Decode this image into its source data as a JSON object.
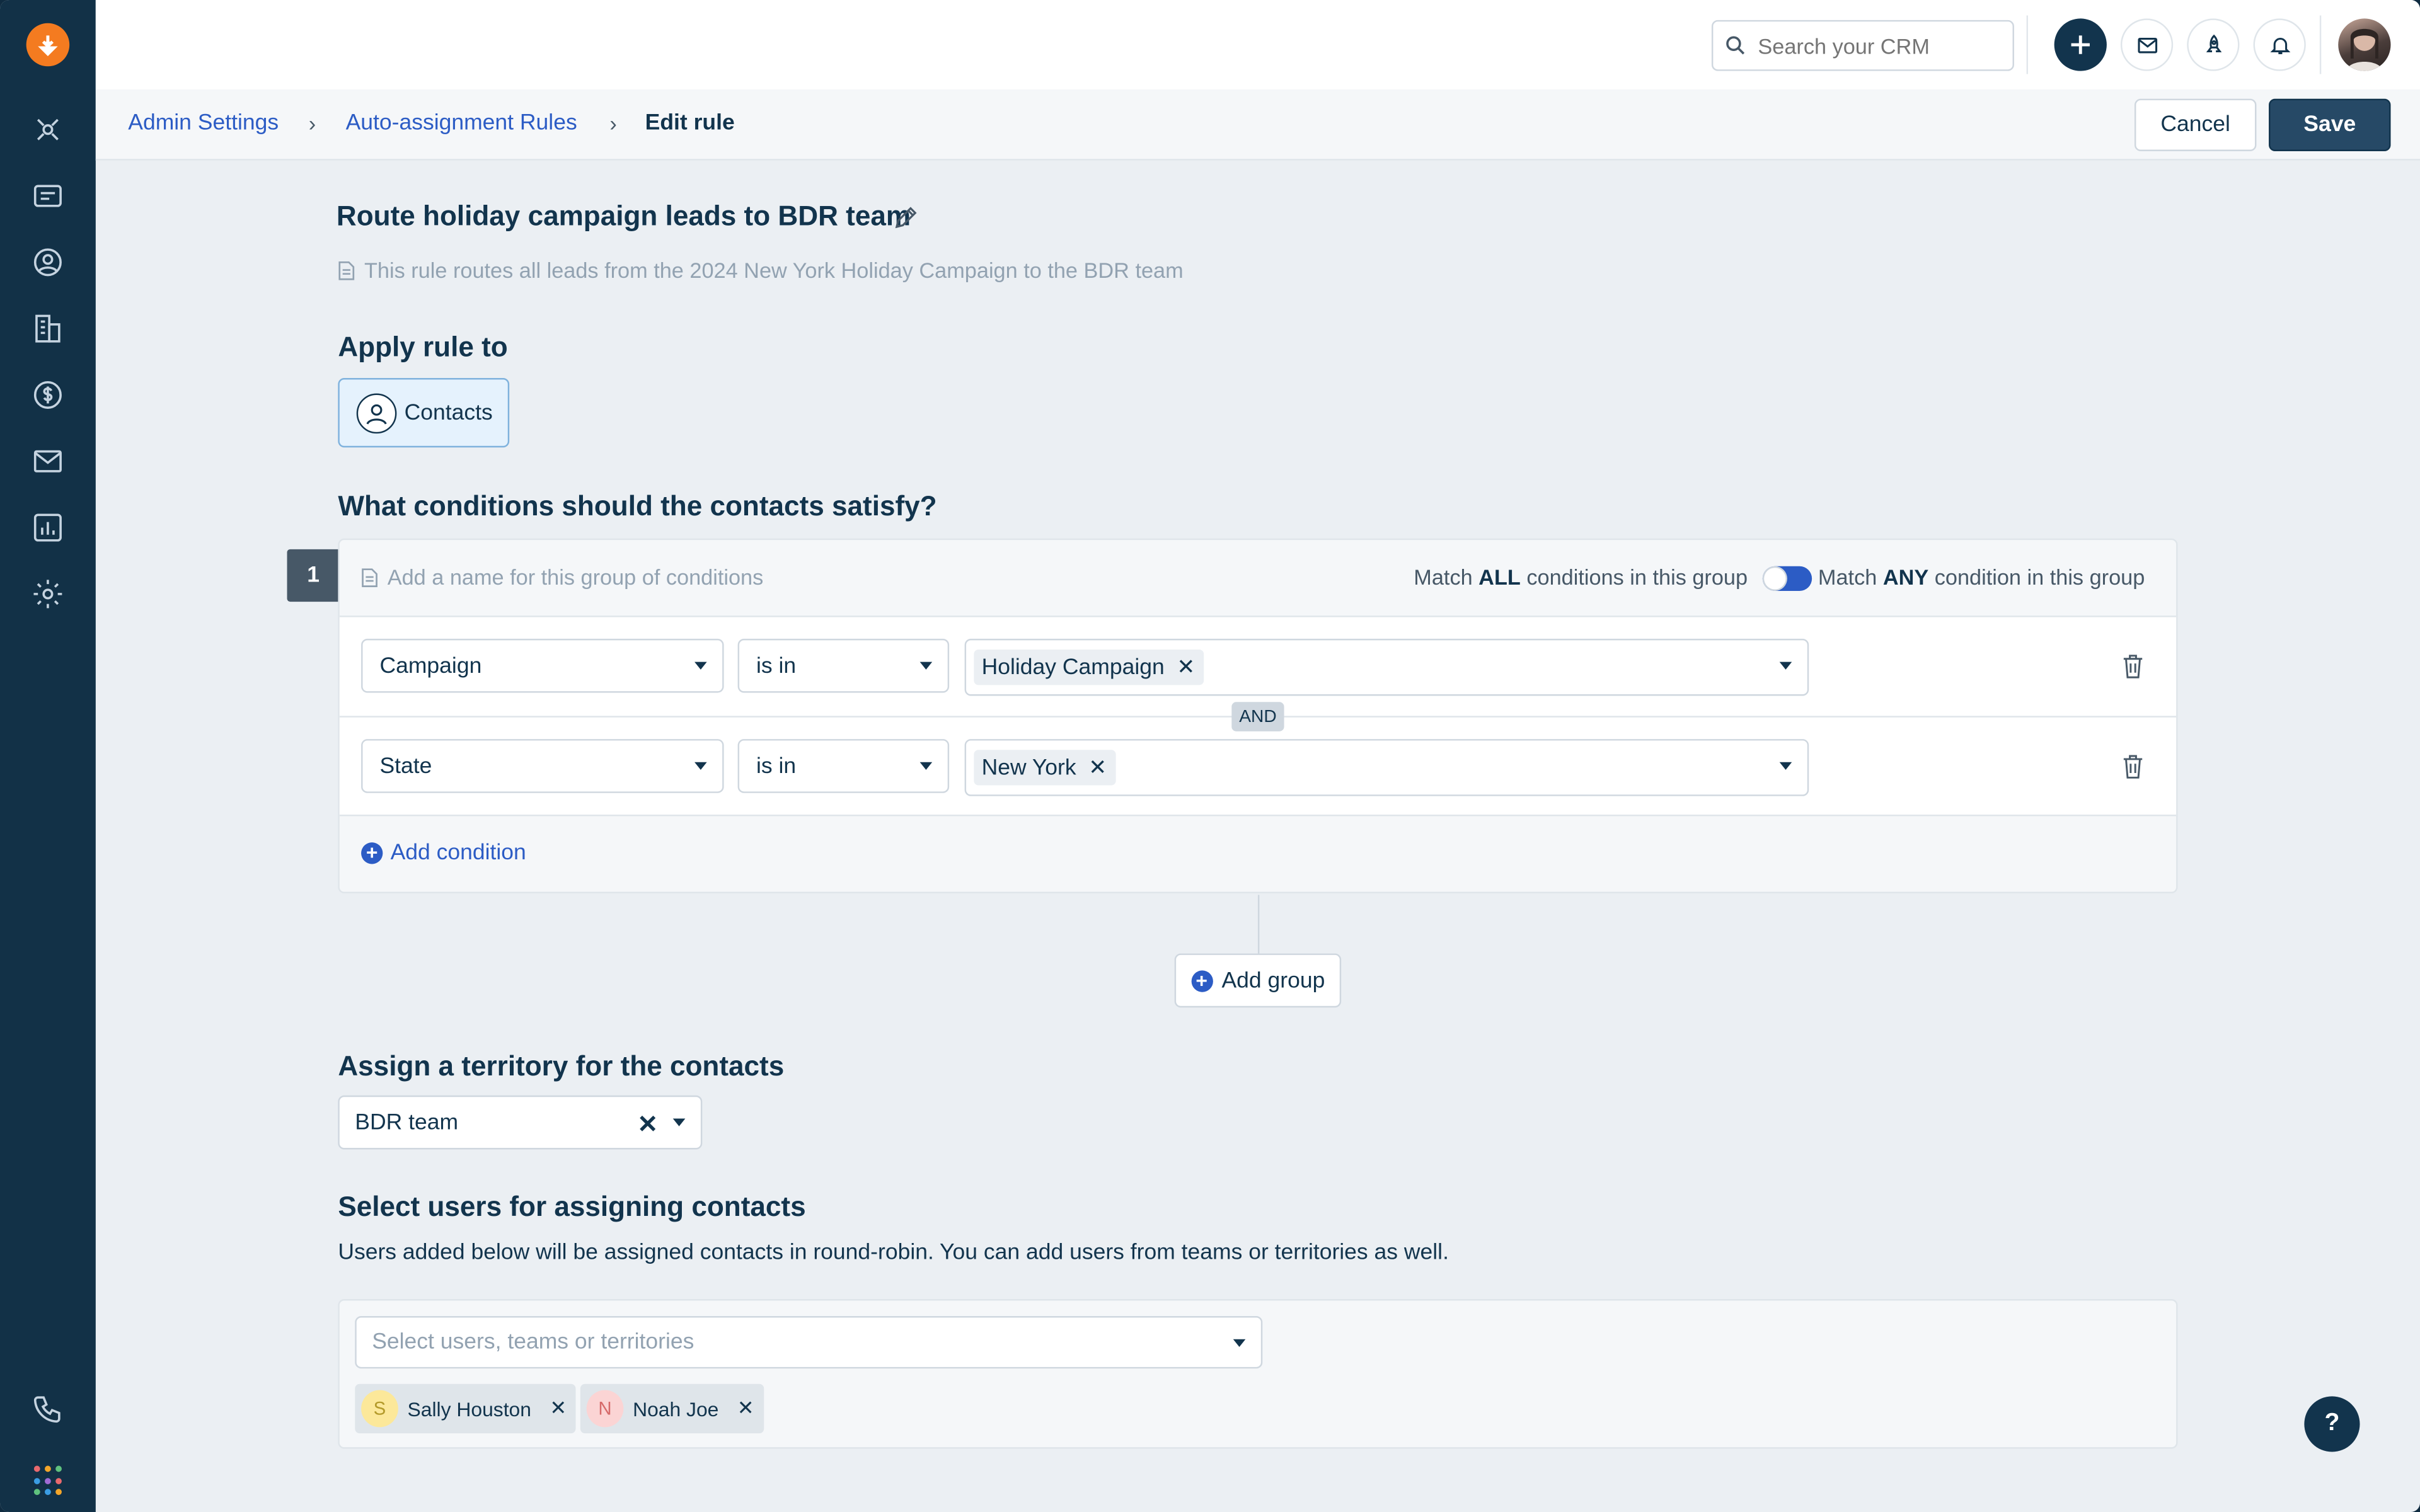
{
  "topbar": {
    "search_placeholder": "Search your CRM"
  },
  "breadcrumb": {
    "items": [
      "Admin Settings",
      "Auto-assignment Rules"
    ],
    "current": "Edit rule"
  },
  "actions": {
    "cancel_label": "Cancel",
    "save_label": "Save"
  },
  "rule": {
    "title": "Route holiday campaign leads to BDR team",
    "description": "This rule routes all leads from the 2024 New York Holiday Campaign to the BDR team"
  },
  "apply_to": {
    "heading": "Apply rule to",
    "option_label": "Contacts"
  },
  "conditions": {
    "heading": "What conditions should the contacts satisfy?",
    "group_number": "1",
    "group_name_placeholder": "Add a name for this group of conditions",
    "match_all_prefix": "Match ",
    "match_all_bold": "ALL",
    "match_all_suffix": " conditions in this group",
    "match_any_prefix": "Match ",
    "match_any_bold": "ANY",
    "match_any_suffix": " condition in this group",
    "rows": [
      {
        "field": "Campaign",
        "operator": "is in",
        "value": "Holiday Campaign"
      },
      {
        "field": "State",
        "operator": "is in",
        "value": "New York"
      }
    ],
    "connector": "AND",
    "add_condition_label": "Add condition",
    "add_group_label": "Add group"
  },
  "territory": {
    "heading": "Assign a territory for the contacts",
    "selected": "BDR team"
  },
  "users": {
    "heading": "Select users for assigning contacts",
    "note": "Users added below will be assigned contacts in round-robin. You can add users from teams or territories as well.",
    "placeholder": "Select users, teams or territories",
    "selected": [
      {
        "initial": "S",
        "name": "Sally Houston",
        "color": "#fce89a"
      },
      {
        "initial": "N",
        "name": "Noah Joe",
        "color": "#fbd4d4"
      }
    ]
  },
  "help_label": "?",
  "colors": {
    "sidebar": "#123147",
    "brand_orange": "#f47b20",
    "link_blue": "#2c5cc5",
    "primary_dark": "#12344d"
  },
  "sidebar_icons": [
    "logo-icon",
    "dashboard-icon",
    "deals-pipeline-icon",
    "contacts-icon",
    "accounts-icon",
    "deals-icon",
    "email-icon",
    "reports-icon",
    "settings-icon",
    "phone-icon",
    "apps-icon"
  ]
}
